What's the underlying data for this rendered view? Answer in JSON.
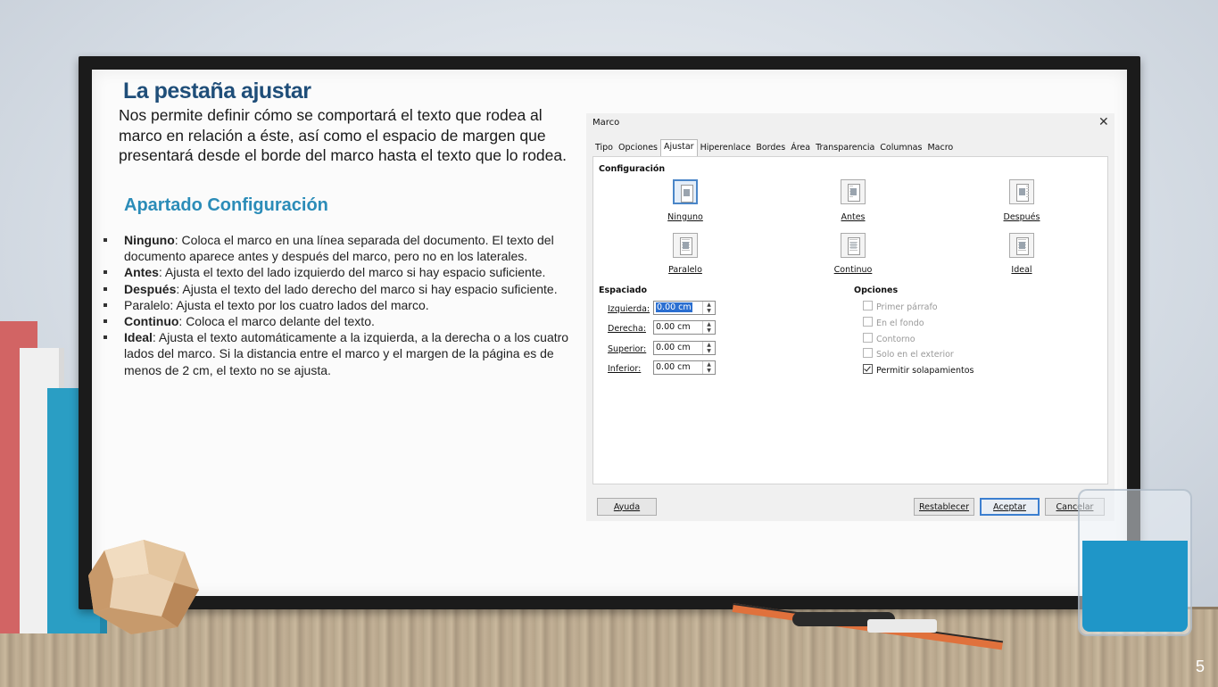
{
  "slide": {
    "title": "La pestaña ajustar",
    "intro": "Nos permite definir cómo se comportará el texto que rodea al marco en relación a éste, así como el espacio de margen que presentará desde el borde del marco hasta el texto que lo rodea.",
    "subtitle": "Apartado Configuración",
    "bullets": [
      {
        "term": "Ninguno",
        "text": ": Coloca el marco en una línea separada del documento. El texto del documento aparece antes y después del marco, pero no en los laterales."
      },
      {
        "term": "Antes",
        "text": ": Ajusta el texto del lado izquierdo del marco si hay espacio suficiente."
      },
      {
        "term": "Después",
        "text": ": Ajusta el texto del lado derecho del marco si hay espacio suficiente."
      },
      {
        "term": "",
        "text": "Paralelo: Ajusta el texto por los cuatro lados del marco."
      },
      {
        "term": "Continuo",
        "text": ": Coloca el marco delante del texto."
      },
      {
        "term": "Ideal",
        "text": ": Ajusta el texto automáticamente a la izquierda, a la derecha o a los cuatro lados del marco. Si la distancia entre el marco y el margen de la página es de menos de 2 cm, el texto no se ajusta."
      }
    ],
    "page_number": "5"
  },
  "dialog": {
    "title": "Marco",
    "close_icon": "close-icon",
    "tabs": [
      "Tipo",
      "Opciones",
      "Ajustar",
      "Hiperenlace",
      "Bordes",
      "Área",
      "Transparencia",
      "Columnas",
      "Macro"
    ],
    "active_tab": "Ajustar",
    "config_heading": "Configuración",
    "wrap_options": [
      {
        "label": "Ninguno",
        "icon": "wrap-none-icon",
        "selected": true
      },
      {
        "label": "Antes",
        "icon": "wrap-before-icon",
        "selected": false
      },
      {
        "label": "Después",
        "icon": "wrap-after-icon",
        "selected": false
      },
      {
        "label": "Paralelo",
        "icon": "wrap-parallel-icon",
        "selected": false
      },
      {
        "label": "Continuo",
        "icon": "wrap-through-icon",
        "selected": false
      },
      {
        "label": "Ideal",
        "icon": "wrap-optimal-icon",
        "selected": false
      }
    ],
    "spacing_heading": "Espaciado",
    "spacing": [
      {
        "label": "Izquierda:",
        "value": "0.00 cm"
      },
      {
        "label": "Derecha:",
        "value": "0.00 cm"
      },
      {
        "label": "Superior:",
        "value": "0.00 cm"
      },
      {
        "label": "Inferior:",
        "value": "0.00 cm"
      }
    ],
    "options_heading": "Opciones",
    "options": [
      {
        "label": "Primer párrafo",
        "checked": false,
        "enabled": false
      },
      {
        "label": "En el fondo",
        "checked": false,
        "enabled": false
      },
      {
        "label": "Contorno",
        "checked": false,
        "enabled": false
      },
      {
        "label": "Solo en el exterior",
        "checked": false,
        "enabled": false
      },
      {
        "label": "Permitir solapamientos",
        "checked": true,
        "enabled": true
      }
    ],
    "buttons": {
      "help": "Ayuda",
      "reset": "Restablecer",
      "ok": "Aceptar",
      "cancel": "Cancelar"
    },
    "accent_color": "#3c7fd0"
  },
  "colors": {
    "title": "#1f4e79",
    "subtitle": "#2b8cb8"
  }
}
